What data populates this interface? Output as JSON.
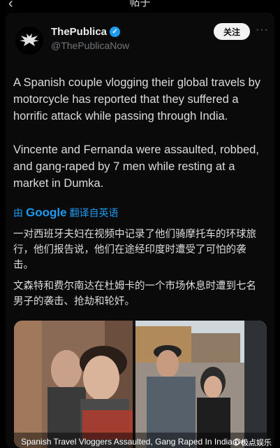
{
  "topbar": {
    "title": "帖子"
  },
  "author": {
    "name": "ThePublica",
    "handle": "@ThePublicaNow"
  },
  "actions": {
    "follow_label": "关注",
    "more_label": "···"
  },
  "post": {
    "paragraph1": "A Spanish couple vlogging their global travels by motorcycle has reported that they suffered a horrific attack while passing through India.",
    "paragraph2": "Vincente and Fernanda were assaulted, robbed, and gang-raped by 7 men while resting at a market in Dumka."
  },
  "translation": {
    "prefix": "由",
    "brand": "Google",
    "suffix": "翻译自英语"
  },
  "translated": {
    "paragraph1": "一对西班牙夫妇在视频中记录了他们骑摩托车的环球旅行，他们报告说，他们在途经印度时遭受了可怕的袭击。",
    "paragraph2": "文森特和费尔南达在杜姆卡的一个市场休息时遭到七名男子的袭击、抢劫和轮奸。"
  },
  "media": {
    "caption": "Spanish Travel Vloggers Assaulted, Gang Raped In India De..."
  },
  "watermark": {
    "text": "极点娱乐"
  },
  "colors": {
    "accent": "#1d9bf0",
    "background": "#000000",
    "text": "#e7e9ea",
    "muted": "#71767b"
  }
}
